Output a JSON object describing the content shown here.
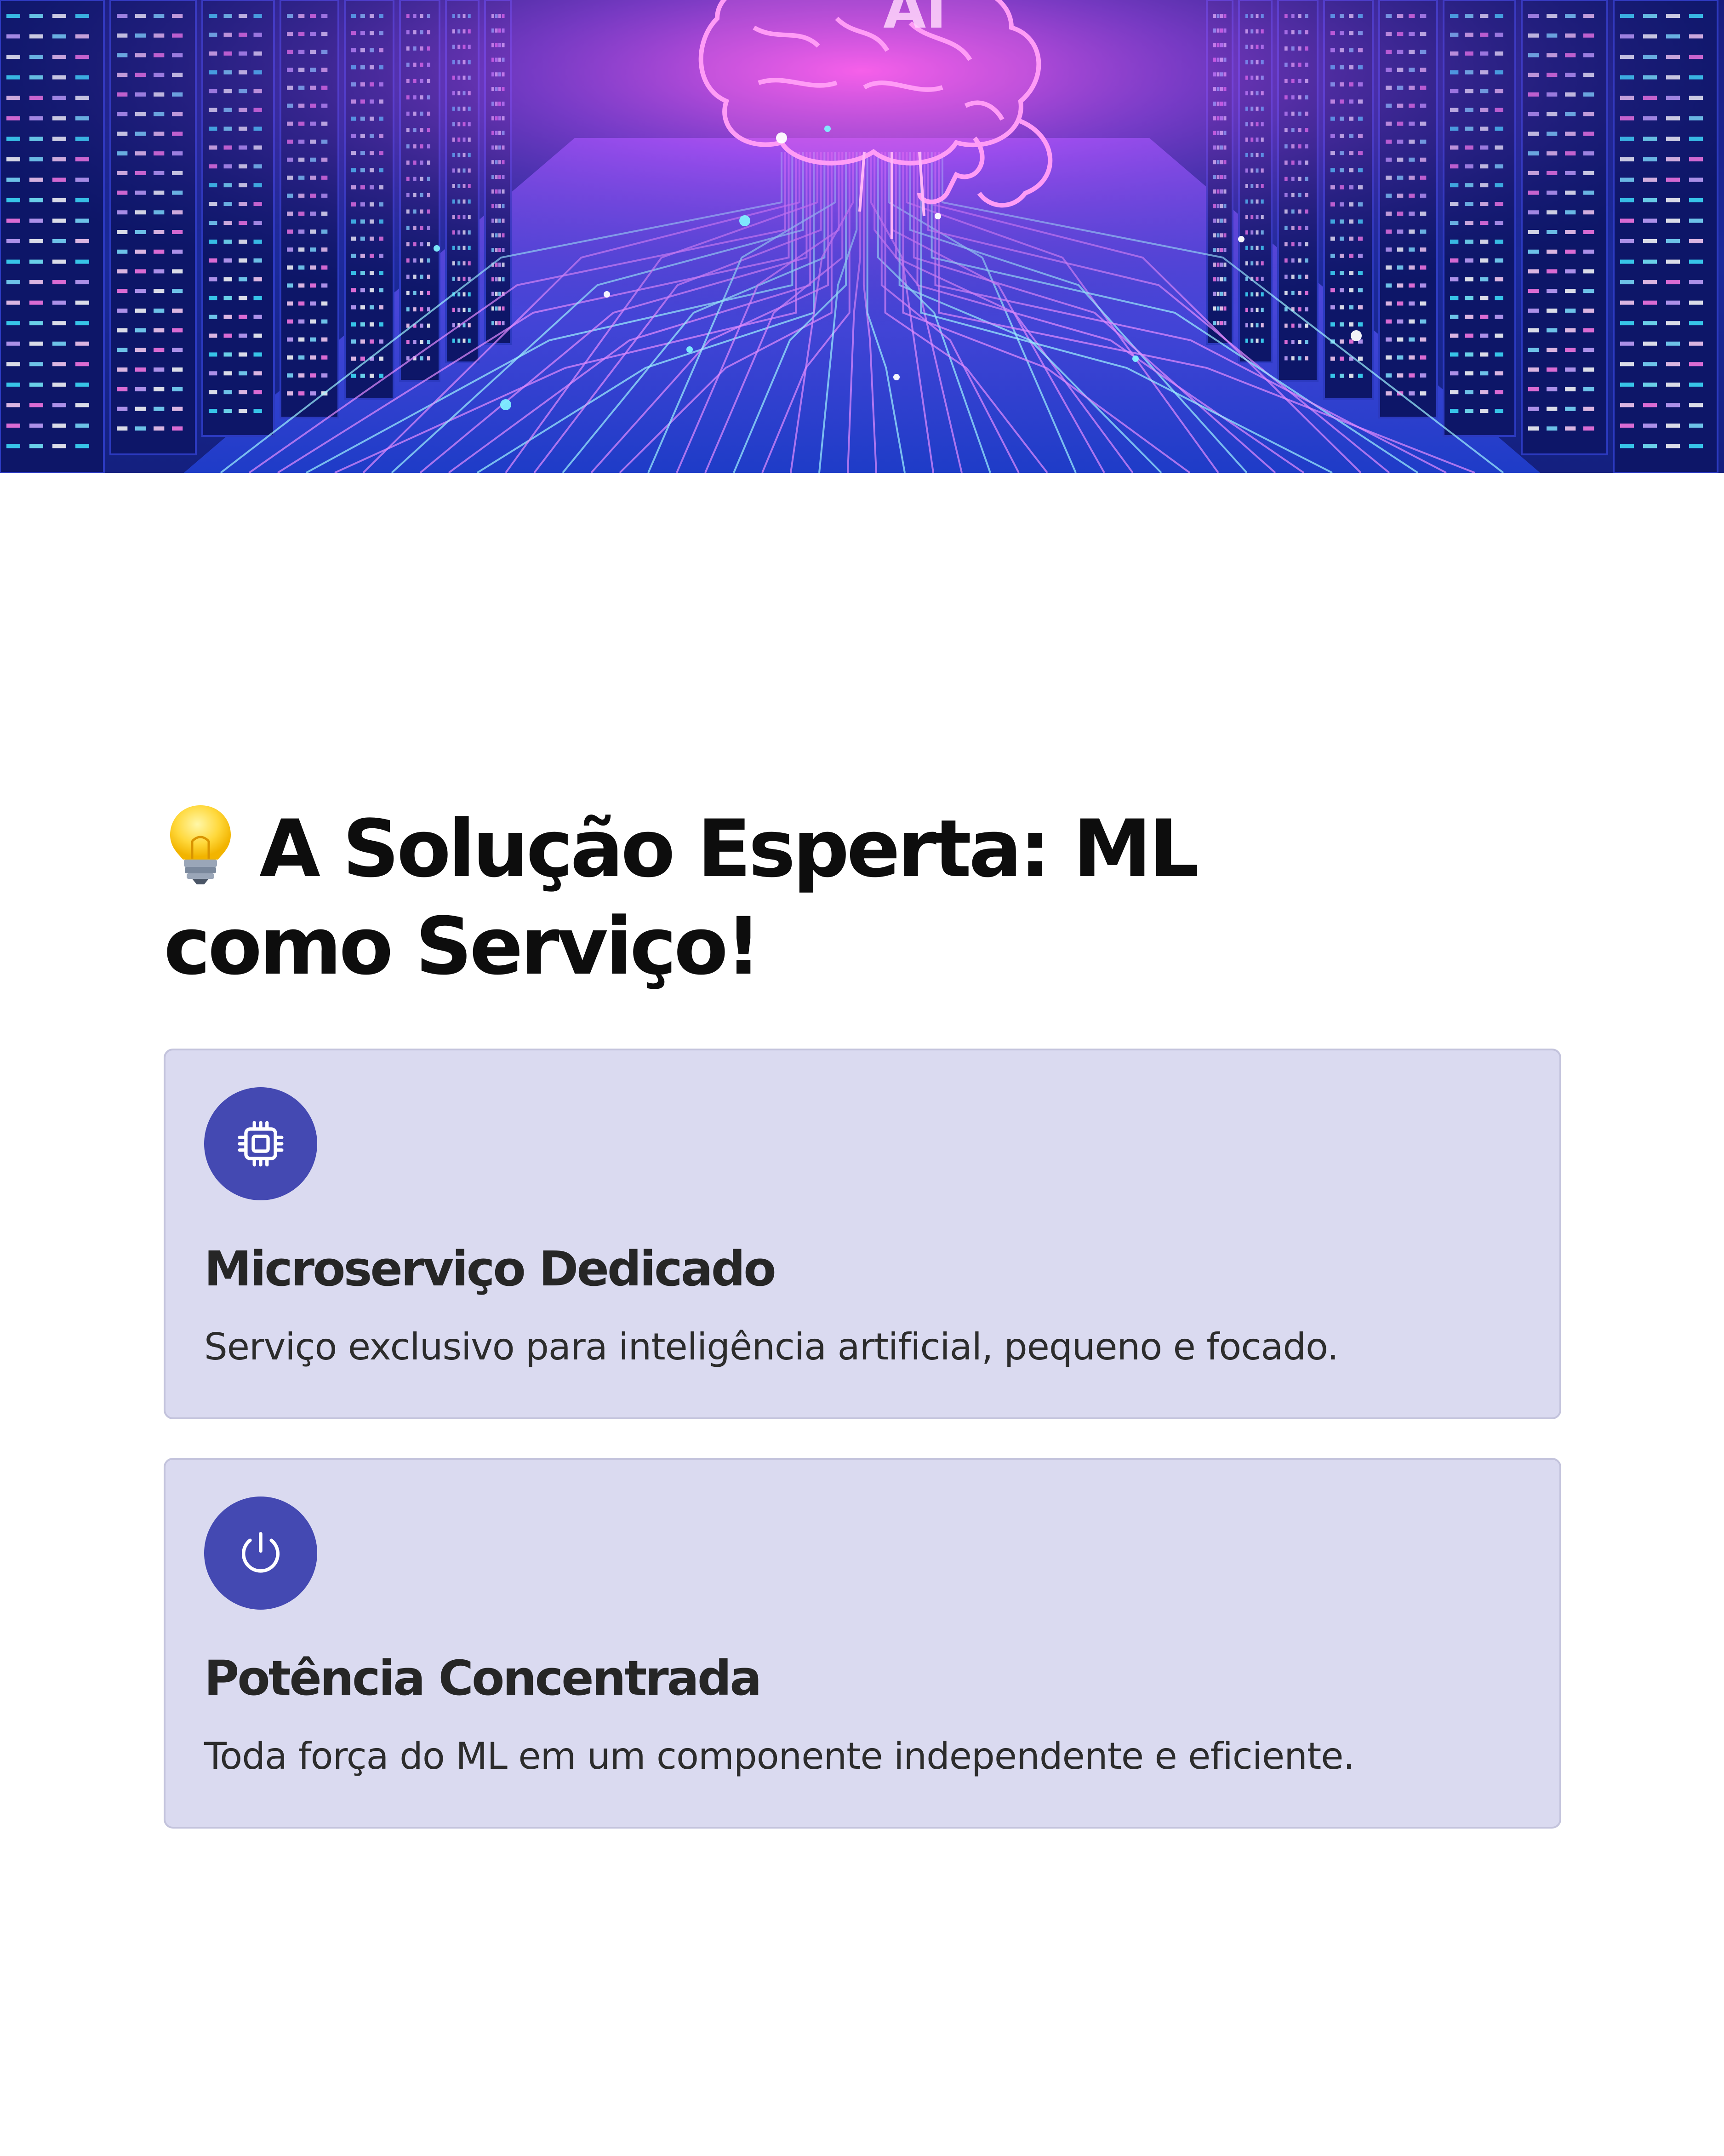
{
  "hero": {
    "icon": "ai-brain-server-illustration",
    "brain_text": "AI"
  },
  "title": {
    "emoji_icon": "lightbulb-icon",
    "text": "A Solução Esperta: ML como Serviço!"
  },
  "cards": [
    {
      "icon": "cpu-chip-icon",
      "title": "Microserviço Dedicado",
      "description": "Serviço exclusivo para inteligência artificial, pequeno e focado."
    },
    {
      "icon": "power-icon",
      "title": "Potência Concentrada",
      "description": "Toda força do ML em um componente independente e eficiente."
    }
  ],
  "colors": {
    "card_background": "#dadaf0",
    "card_border": "#c3c3dc",
    "icon_circle": "#4449b2",
    "hero_glow": "#ff4fe0",
    "hero_cyan": "#36d8ff"
  }
}
